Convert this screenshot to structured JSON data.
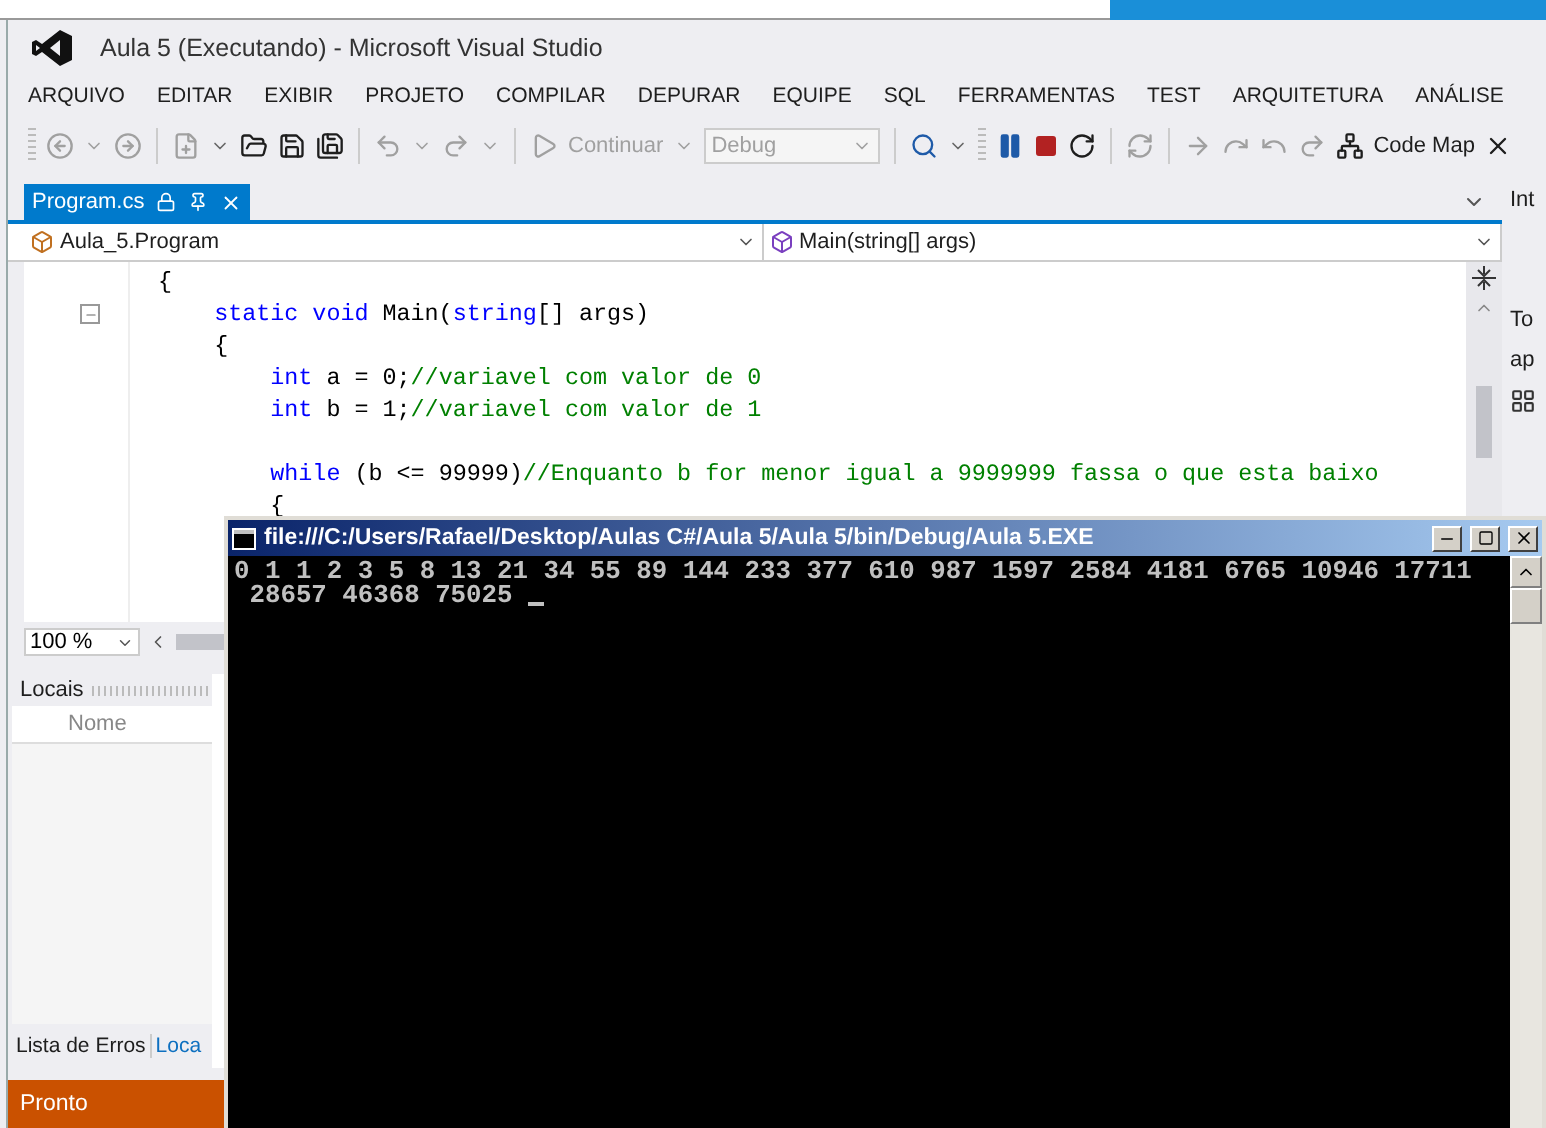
{
  "window": {
    "title": "Aula 5 (Executando) - Microsoft Visual Studio"
  },
  "menu": [
    "ARQUIVO",
    "EDITAR",
    "EXIBIR",
    "PROJETO",
    "COMPILAR",
    "DEPURAR",
    "EQUIPE",
    "SQL",
    "FERRAMENTAS",
    "TEST",
    "ARQUITETURA",
    "ANÁLISE"
  ],
  "toolbar": {
    "continue_label": "Continuar",
    "configuration": "Debug",
    "code_map_label": "Code Map"
  },
  "editor": {
    "tabs": [
      {
        "label": "Program.cs",
        "selected": true
      }
    ],
    "type_dropdown": "Aula_5.Program",
    "member_dropdown": "Main(string[] args)",
    "lines": [
      {
        "fold": false,
        "segments": [
          {
            "kind": "plain",
            "text": "  {"
          }
        ]
      },
      {
        "fold": true,
        "segments": [
          {
            "kind": "keyword",
            "text": "      static void"
          },
          {
            "kind": "plain",
            "text": " Main("
          },
          {
            "kind": "keyword",
            "text": "string"
          },
          {
            "kind": "plain",
            "text": "[] args)"
          }
        ]
      },
      {
        "fold": false,
        "segments": [
          {
            "kind": "plain",
            "text": "      {"
          }
        ]
      },
      {
        "fold": false,
        "segments": [
          {
            "kind": "keyword",
            "text": "          int"
          },
          {
            "kind": "plain",
            "text": " a = 0;"
          },
          {
            "kind": "comment",
            "text": "//variavel com valor de 0"
          }
        ]
      },
      {
        "fold": false,
        "segments": [
          {
            "kind": "keyword",
            "text": "          int"
          },
          {
            "kind": "plain",
            "text": " b = 1;"
          },
          {
            "kind": "comment",
            "text": "//variavel com valor de 1"
          }
        ]
      },
      {
        "fold": false
      },
      {
        "fold": false,
        "segments": [
          {
            "kind": "keyword",
            "text": "          while"
          },
          {
            "kind": "plain",
            "text": " (b <= 99999)"
          },
          {
            "kind": "comment",
            "text": "//Enquanto b for menor igual a 9999999 fassa o que esta baixo"
          }
        ]
      },
      {
        "fold": false,
        "segments": [
          {
            "kind": "plain",
            "text": "          {"
          }
        ]
      }
    ],
    "zoom": "100 %"
  },
  "side_panel": {
    "texts": [
      "Int",
      "To",
      "ap"
    ]
  },
  "locals": {
    "title": "Locais",
    "column": "Nome"
  },
  "bottom_tabs": [
    {
      "label": "Lista de Erros",
      "selected": false
    },
    {
      "label": "Loca",
      "selected": true
    }
  ],
  "status_bar": "Pronto",
  "console": {
    "title": "file:///C:/Users/Rafael/Desktop/Aulas C#/Aula 5/Aula 5/bin/Debug/Aula 5.EXE",
    "lines": [
      "0 1 1 2 3 5 8 13 21 34 55 89 144 233 377 610 987 1597 2584 4181 6765 10946 17711",
      " 28657 46368 75025 "
    ]
  }
}
